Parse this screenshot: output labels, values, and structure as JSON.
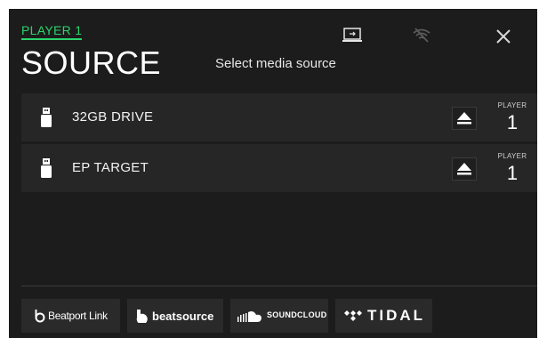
{
  "header": {
    "player_tab": "PLAYER 1",
    "title": "SOURCE",
    "subtitle": "Select media source"
  },
  "top_icons": [
    "computer-usb-icon",
    "wifi-off-icon",
    "close-icon"
  ],
  "sources": [
    {
      "name": "32GB DRIVE",
      "player_label": "PLAYER",
      "player_number": "1",
      "icon": "usb-drive-icon"
    },
    {
      "name": "EP TARGET",
      "player_label": "PLAYER",
      "player_number": "1",
      "icon": "usb-drive-icon"
    }
  ],
  "services": [
    {
      "label": "Beatport Link",
      "icon": "beatport-icon"
    },
    {
      "label": "beatsource",
      "icon": "beatsource-icon"
    },
    {
      "label": "SOUNDCLOUD",
      "icon": "soundcloud-icon"
    },
    {
      "label": "TIDAL",
      "icon": "tidal-icon"
    }
  ],
  "colors": {
    "accent": "#2bd46c",
    "background": "#1c1c1c",
    "row": "#262626"
  }
}
